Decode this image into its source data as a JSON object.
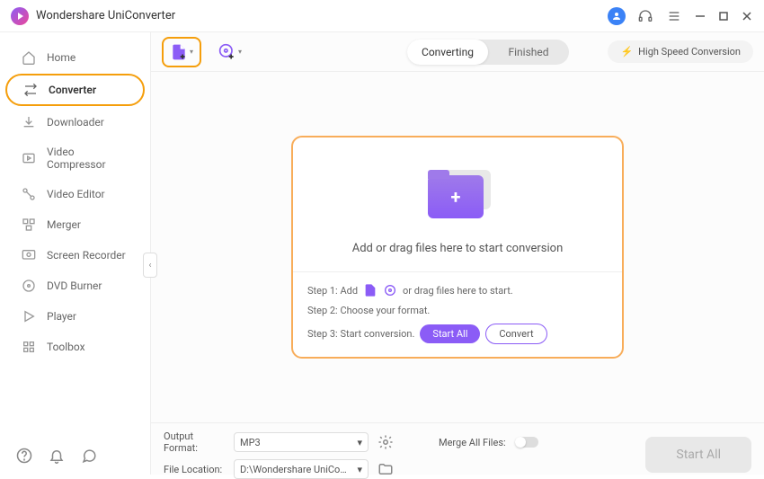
{
  "titlebar": {
    "title": "Wondershare UniConverter"
  },
  "sidebar": {
    "items": [
      {
        "label": "Home",
        "icon": "home-icon"
      },
      {
        "label": "Converter",
        "icon": "converter-icon",
        "active": true
      },
      {
        "label": "Downloader",
        "icon": "downloader-icon"
      },
      {
        "label": "Video Compressor",
        "icon": "compressor-icon"
      },
      {
        "label": "Video Editor",
        "icon": "editor-icon"
      },
      {
        "label": "Merger",
        "icon": "merger-icon"
      },
      {
        "label": "Screen Recorder",
        "icon": "recorder-icon"
      },
      {
        "label": "DVD Burner",
        "icon": "dvd-icon"
      },
      {
        "label": "Player",
        "icon": "player-icon"
      },
      {
        "label": "Toolbox",
        "icon": "toolbox-icon"
      }
    ]
  },
  "toolbar": {
    "tabs": [
      {
        "label": "Converting",
        "active": true
      },
      {
        "label": "Finished",
        "active": false
      }
    ],
    "speed": "High Speed Conversion"
  },
  "dropzone": {
    "text": "Add or drag files here to start conversion",
    "step1_label": "Step 1: Add",
    "step1_tail": "or drag files here to start.",
    "step2": "Step 2: Choose your format.",
    "step3": "Step 3: Start conversion.",
    "start_all": "Start All",
    "convert": "Convert"
  },
  "bottombar": {
    "output_format_label": "Output Format:",
    "output_format_value": "MP3",
    "file_location_label": "File Location:",
    "file_location_value": "D:\\Wondershare UniConverter",
    "merge_label": "Merge All Files:",
    "start_all": "Start All"
  }
}
